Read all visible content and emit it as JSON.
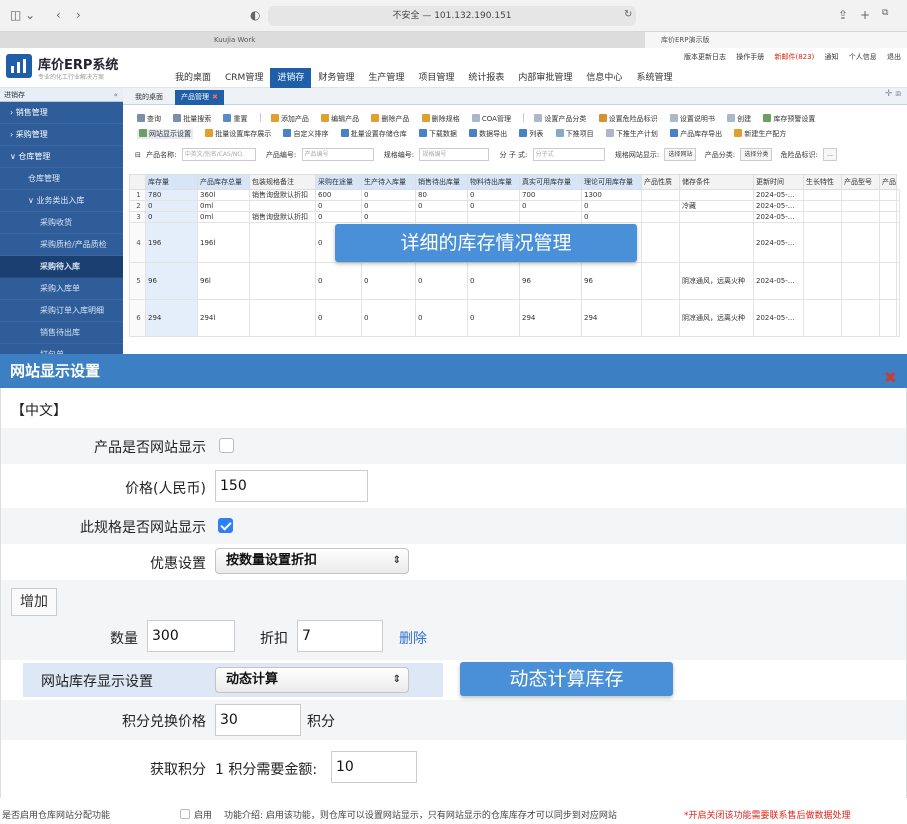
{
  "browser": {
    "url": "不安全 — 101.132.190.151",
    "tabs": [
      "Kuujia Work",
      "库价ERP演示版"
    ]
  },
  "header": {
    "app_title": "库价ERP系统",
    "app_subtitle": "专业的化工行业解决方案",
    "top_links": [
      "版本更新日志",
      "操作手册",
      "新邮件(823)",
      "通知",
      "个人信息",
      "退出"
    ],
    "nav": [
      "我的桌面",
      "CRM管理",
      "进销存",
      "财务管理",
      "生产管理",
      "项目管理",
      "统计报表",
      "内部审批管理",
      "信息中心",
      "系统管理"
    ],
    "active_nav_index": 2
  },
  "sidebar": {
    "title": "进销存",
    "collapse": "«",
    "items": [
      {
        "label": "› 销售管理",
        "level": 1
      },
      {
        "label": "› 采购管理",
        "level": 1
      },
      {
        "label": "∨ 仓库管理",
        "level": 1
      },
      {
        "label": "仓库管理",
        "level": 2
      },
      {
        "label": "∨ 业务类出入库",
        "level": 2
      },
      {
        "label": "采购收货",
        "level": 3
      },
      {
        "label": "采购质检/产品质检",
        "level": 3
      },
      {
        "label": "采购待入库",
        "level": 3,
        "active": true
      },
      {
        "label": "采购入库单",
        "level": 3
      },
      {
        "label": "采购订单入库明细",
        "level": 3
      },
      {
        "label": "销售待出库",
        "level": 3
      },
      {
        "label": "打包单",
        "level": 3
      }
    ]
  },
  "page_tabs": [
    "我的桌面",
    "产品管理"
  ],
  "toolbar": {
    "row1": [
      "查询",
      "批量搜索",
      "重置",
      "添加产品",
      "编辑产品",
      "删除产品",
      "删除规格",
      "COA管理",
      "设置产品分类",
      "设置危险品标识",
      "设置说明书",
      "创建",
      "库存预警设置"
    ],
    "row2": [
      "网站显示设置",
      "批量设置库存展示",
      "自定义排序",
      "批量设置存储仓库",
      "下载数据",
      "数据导出",
      "列表",
      "下推项目",
      "下推生产计划",
      "产品库存导出",
      "新建生产配方"
    ]
  },
  "filters": {
    "product_name_label": "产品名称:",
    "product_name_placeholder": "中英文/别名/CAS/NO.",
    "product_code_label": "产品编号:",
    "product_code_placeholder": "产品编号",
    "spec_code_label": "规格编号:",
    "spec_code_placeholder": "规格编号",
    "formula_label": "分 子 式:",
    "formula_placeholder": "分子式",
    "spec_display_label": "规格网站显示:",
    "spec_display_value": "选择网站",
    "category_label": "产品分类:",
    "category_value": "选择分类",
    "danger_label": "危险品标识:",
    "danger_value": "..."
  },
  "grid": {
    "headers": [
      "库存量",
      "产品库存总量",
      "包装规格备注",
      "采购在途量",
      "生产待入库量",
      "销售待出库量",
      "物料待出库量",
      "真实可用库存量",
      "理论可用库存量",
      "产品性质",
      "储存条件",
      "更新时间",
      "生长特性",
      "产品型号",
      "产品"
    ],
    "rows": [
      {
        "n": "1",
        "cells": [
          "780",
          "360l",
          "销售询盘默认折扣",
          "600",
          "0",
          "80",
          "0",
          "700",
          "1300",
          "",
          "",
          "2024-05-...",
          "",
          "",
          ""
        ]
      },
      {
        "n": "2",
        "cells": [
          "0",
          "0ml",
          "",
          "0",
          "0",
          "0",
          "0",
          "0",
          "0",
          "",
          "冷藏",
          "2024-05-...",
          "",
          "",
          ""
        ]
      },
      {
        "n": "3",
        "cells": [
          "0",
          "0ml",
          "销售询盘默认折扣",
          "0",
          "0",
          "",
          "",
          "",
          "0",
          "",
          "",
          "2024-05-...",
          "",
          "",
          ""
        ]
      },
      {
        "n": "4",
        "cells": [
          "196",
          "196l",
          "",
          "0",
          "0",
          "",
          "",
          "196",
          "196",
          "",
          "",
          "2024-05-...",
          "",
          "",
          ""
        ]
      },
      {
        "n": "5",
        "cells": [
          "96",
          "96l",
          "",
          "0",
          "0",
          "0",
          "0",
          "96",
          "96",
          "",
          "阴凉通风，远离火种",
          "2024-05-...",
          "",
          "",
          ""
        ]
      },
      {
        "n": "6",
        "cells": [
          "294",
          "294l",
          "",
          "0",
          "0",
          "0",
          "0",
          "294",
          "294",
          "",
          "阴凉通风，远离火种",
          "2024-05-...",
          "",
          "",
          ""
        ]
      }
    ]
  },
  "callouts": {
    "inventory": "详细的库存情况管理",
    "dynamic": "动态计算库存"
  },
  "dialog": {
    "title": "网站显示设置",
    "section": "【中文】",
    "show_product_label": "产品是否网站显示",
    "show_product_checked": false,
    "price_label": "价格(人民币)",
    "price_value": "150",
    "show_spec_label": "此规格是否网站显示",
    "show_spec_checked": true,
    "discount_label": "优惠设置",
    "discount_value": "按数量设置折扣",
    "add_label": "增加",
    "qty_label": "数量",
    "qty_value": "300",
    "rate_label": "折扣",
    "rate_value": "7",
    "delete_label": "删除",
    "stock_display_label": "网站库存显示设置",
    "stock_display_value": "动态计算",
    "points_price_label": "积分兑换价格",
    "points_price_value": "30",
    "points_unit": "积分",
    "earn_points_label": "获取积分",
    "earn_points_text": "1 积分需要金额:",
    "earn_points_value": "10"
  },
  "footer": {
    "label": "是否启用仓库网站分配功能",
    "option": "启用",
    "desc": "功能介绍: 启用该功能，则仓库可以设置网站显示，只有网站显示的仓库库存才可以同步到对应网站",
    "warning": "*开启关闭该功能需要联系售后做数据处理"
  },
  "colors": {
    "brand": "#1f5fa8",
    "callout": "#4a90d9",
    "dialog_title": "#3c80c3",
    "checkbox": "#2f7ff7",
    "warn": "#e0231a"
  }
}
